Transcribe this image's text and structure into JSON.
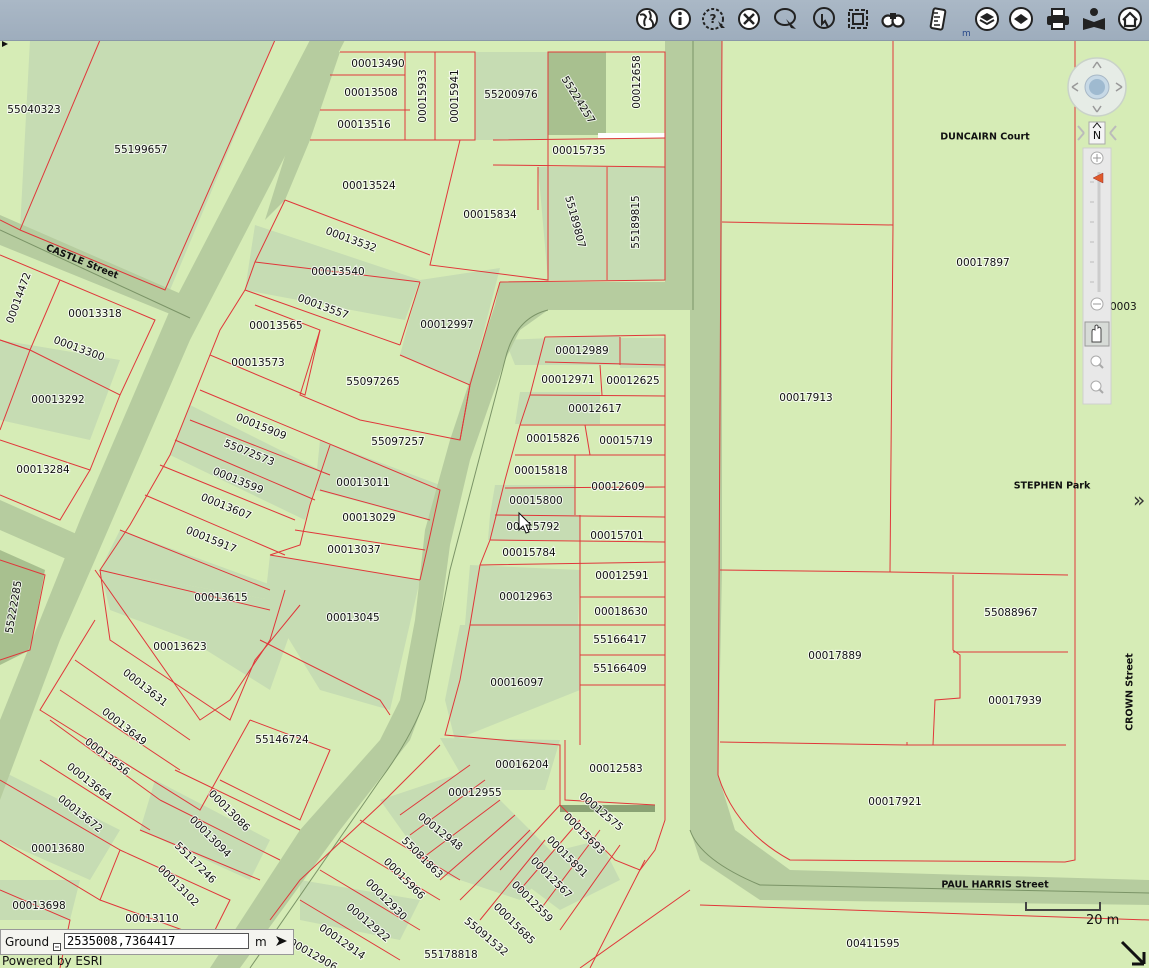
{
  "toolbar": {
    "tools": [
      {
        "icon": "globe-icon"
      },
      {
        "icon": "info-icon"
      },
      {
        "icon": "query-icon"
      },
      {
        "icon": "clear-icon"
      },
      {
        "icon": "lasso-select-icon"
      },
      {
        "icon": "identify-icon"
      },
      {
        "icon": "extent-icon"
      },
      {
        "icon": "binoculars-icon"
      },
      {
        "icon": "measure-icon"
      },
      {
        "icon": "layers-icon"
      },
      {
        "icon": "basemap-icon"
      },
      {
        "icon": "print-icon"
      },
      {
        "icon": "reader-icon"
      },
      {
        "icon": "home-icon"
      }
    ],
    "unit_small": "m"
  },
  "map": {
    "parcels": [
      "00013490",
      "00013508",
      "00013516",
      "00015933",
      "00015941",
      "55200976",
      "55224257",
      "00012658",
      "00015735",
      "00015834",
      "55189807",
      "55189815",
      "00013524",
      "00013532",
      "00013540",
      "00013557",
      "00013565",
      "00013573",
      "55097265",
      "00012997",
      "55040323",
      "55199657",
      "00014472",
      "00013318",
      "00013300",
      "00013292",
      "00013284",
      "00015909",
      "55072573",
      "00013599",
      "00013607",
      "00015917",
      "55097257",
      "00013011",
      "00013029",
      "00013037",
      "00013045",
      "00013615",
      "00013623",
      "00013631",
      "00013649",
      "00013656",
      "00013664",
      "00013672",
      "00013680",
      "00013698",
      "55222285",
      "55146724",
      "00013086",
      "00013094",
      "55117246",
      "00013102",
      "00013110",
      "00012989",
      "00012971",
      "00012625",
      "00012617",
      "00015826",
      "00015719",
      "00015818",
      "00012609",
      "00015800",
      "00015792",
      "00015701",
      "00015784",
      "00012591",
      "00012963",
      "00018630",
      "55166417",
      "55166409",
      "00016097",
      "00016204",
      "00012583",
      "00012955",
      "00012948",
      "55081863",
      "00015966",
      "00012930",
      "00012922",
      "00012914",
      "00012906",
      "55178818",
      "55091532",
      "00015685",
      "00012559",
      "00012567",
      "00015891",
      "00015693",
      "00012575",
      "00017897",
      "00017913",
      "00017889",
      "55088967",
      "00017939",
      "00017921",
      "00411595",
      "0003"
    ],
    "streets": {
      "castle": "CASTLE Street",
      "duncairn": "DUNCAIRN Court",
      "stephen": "STEPHEN Park",
      "crown": "CROWN Street",
      "paul_harris": "PAUL HARRIS Street"
    }
  },
  "coordinates": {
    "label": "Ground",
    "value": "2535008,7364417",
    "unit": "m"
  },
  "attribution": "Powered by ESRI",
  "scale": {
    "label": "20 m"
  },
  "colors": {
    "parcel_fill": "#d6ecb6",
    "parcel_alt": "#c6dcb3",
    "road": "#b6cc9f",
    "parcel_line": "#e0373a",
    "toolbar": "#a4b2c2"
  }
}
